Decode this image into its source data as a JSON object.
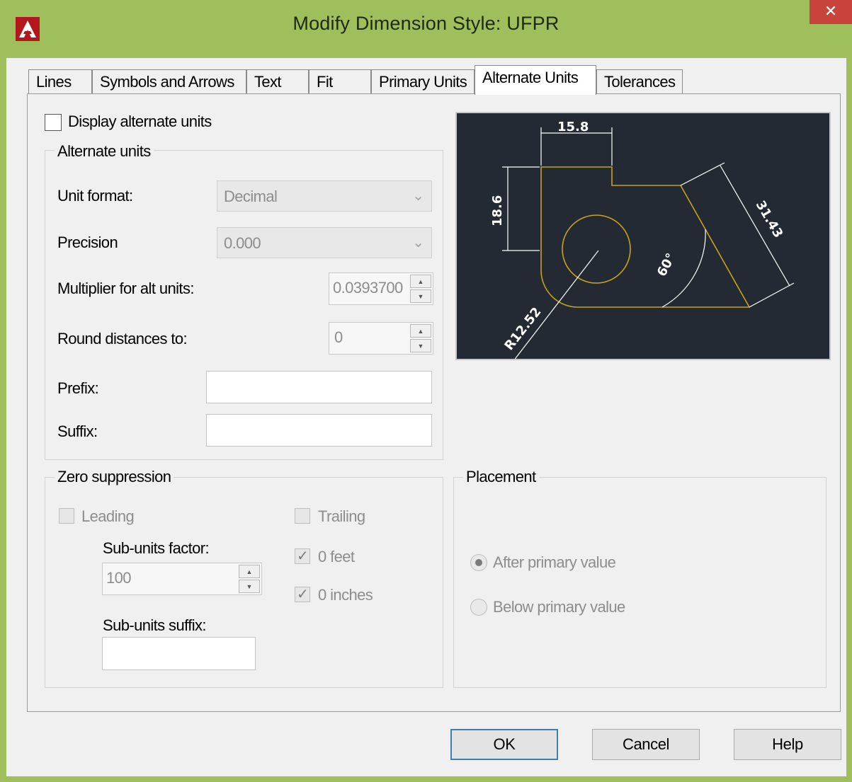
{
  "window": {
    "title": "Modify Dimension Style: UFPR",
    "close_glyph": "✕",
    "app_icon": "autocad-logo-icon",
    "accent_color": "#9fbf5c"
  },
  "tabs": [
    {
      "label": "Lines",
      "active": false
    },
    {
      "label": "Symbols and Arrows",
      "active": false
    },
    {
      "label": "Text",
      "active": false
    },
    {
      "label": "Fit",
      "active": false
    },
    {
      "label": "Primary Units",
      "active": false
    },
    {
      "label": "Alternate Units",
      "active": true
    },
    {
      "label": "Tolerances",
      "active": false
    }
  ],
  "display_alternate_units": {
    "label": "Display alternate units",
    "checked": false
  },
  "alternate_units": {
    "legend": "Alternate units",
    "unit_format": {
      "label": "Unit format:",
      "value": "Decimal"
    },
    "precision": {
      "label": "Precision",
      "value": "0.000"
    },
    "multiplier": {
      "label": "Multiplier for alt units:",
      "value": "0.0393700"
    },
    "round_distances": {
      "label": "Round distances  to:",
      "value": "0"
    },
    "prefix": {
      "label": "Prefix:",
      "value": ""
    },
    "suffix": {
      "label": "Suffix:",
      "value": ""
    }
  },
  "zero_suppression": {
    "legend": "Zero suppression",
    "leading": {
      "label": "Leading",
      "checked": false
    },
    "trailing": {
      "label": "Trailing",
      "checked": false
    },
    "sub_units_factor": {
      "label": "Sub-units factor:",
      "value": "100"
    },
    "sub_units_suffix": {
      "label": "Sub-units suffix:",
      "value": ""
    },
    "zero_feet": {
      "label": "0 feet",
      "checked": true
    },
    "zero_inches": {
      "label": "0 inches",
      "checked": true
    }
  },
  "placement": {
    "legend": "Placement",
    "after": {
      "label": "After primary value",
      "selected": true
    },
    "below": {
      "label": "Below primary value",
      "selected": false
    }
  },
  "preview": {
    "dim_top": "15.8",
    "dim_left": "18.6",
    "dim_slant": "31.43",
    "dim_angle": "60°",
    "dim_radius": "R12.52",
    "geometry_color": "#c9a21a",
    "background_color": "#232a33"
  },
  "buttons": {
    "ok": "OK",
    "cancel": "Cancel",
    "help": "Help"
  },
  "check_glyph": "✓",
  "spin_up": "▲",
  "spin_down": "▼",
  "combo_arrow": "⌄"
}
